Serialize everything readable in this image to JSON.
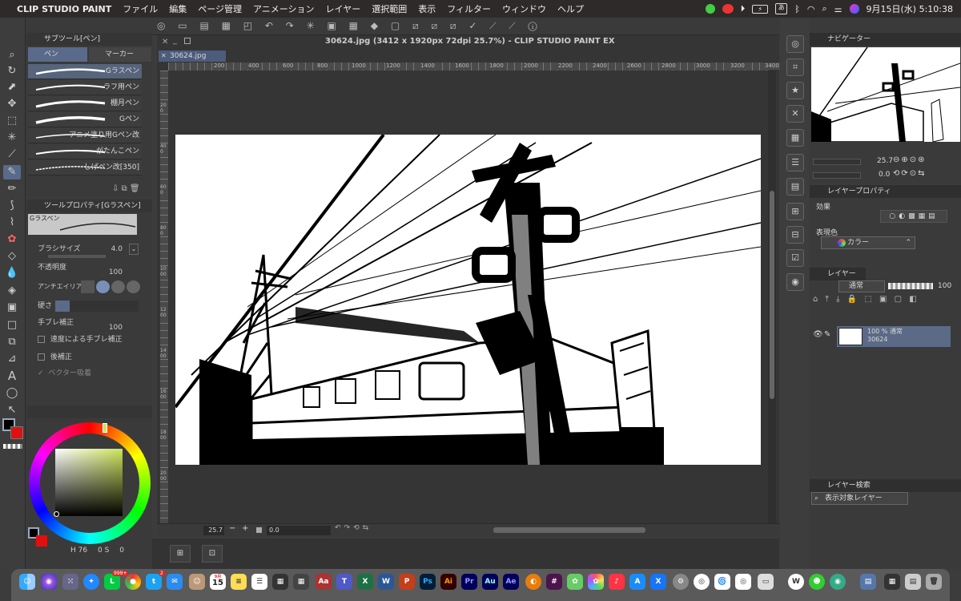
{
  "menubar": {
    "apple_icon": "apple-icon",
    "app_name": "CLIP STUDIO PAINT",
    "items": [
      "ファイル",
      "編集",
      "ページ管理",
      "アニメーション",
      "レイヤー",
      "選択範囲",
      "表示",
      "フィルター",
      "ウィンドウ",
      "ヘルプ"
    ],
    "input_method": "あ",
    "datetime": "9月15日(水)  5:10:38"
  },
  "window_title": "30624.jpg (3412 x 1920px 72dpi 25.7%)  - CLIP STUDIO PAINT EX",
  "document_tab": "30624.jpg",
  "ruler_top": [
    "200",
    "400",
    "600",
    "800",
    "1000",
    "1200",
    "1400",
    "1600",
    "1800",
    "2000",
    "2200",
    "2400",
    "2600",
    "2800",
    "3000",
    "3200",
    "3400"
  ],
  "ruler_left": [
    "200",
    "400",
    "600",
    "800",
    "1000",
    "1200",
    "1400",
    "1600",
    "1800",
    "2000"
  ],
  "subtool_panel": {
    "title": "サブツール[ペン]",
    "tabs": [
      "ペン",
      "マーカー"
    ],
    "brushes": [
      "Gラスペン",
      "ラフ用ペン",
      "棚月ペン",
      "Gペン",
      "アニメ塗り用Gペン改",
      "がたんこペン",
      "しげペン改[350]"
    ]
  },
  "tool_property": {
    "title": "ツールプロパティ[Gラスペン]",
    "preview_label": "Gラスペン",
    "brush_size_label": "ブラシサイズ",
    "brush_size": "4.0",
    "opacity_label": "不透明度",
    "opacity": "100",
    "antialias_label": "アンチエイリアス",
    "hardness_label": "硬さ",
    "stabilization_label": "手ブレ補正",
    "stabilization": "100",
    "speed_stab_label": "速度による手ブレ補正",
    "post_correction_label": "後補正",
    "vector_snap_label": "ベクター吸着"
  },
  "color_panel": {
    "main_color": "#000000",
    "sub_color": "#e01010",
    "h_label": "H",
    "h_value": "76",
    "s_label": "S",
    "s_value": "0",
    "v_label": "V",
    "v_value": "0"
  },
  "canvas_status": {
    "zoom": "25.7",
    "rotation": "0.0"
  },
  "navigator": {
    "title": "ナビゲーター",
    "zoom": "25.7",
    "rotation": "0.0"
  },
  "layer_property": {
    "title": "レイヤープロパティ",
    "effect_label": "効果",
    "expression_label": "表現色",
    "expression_value": "カラー"
  },
  "layer_panel": {
    "title": "レイヤー",
    "blend_mode": "通常",
    "opacity": "100",
    "layers": [
      {
        "line1": "100 % 通常",
        "line2": "30624"
      }
    ]
  },
  "layer_search": {
    "title": "レイヤー検索",
    "filter": "表示対象レイヤー"
  },
  "dock": {
    "badges": [
      "999+",
      "2"
    ],
    "calendar_month": "9月",
    "calendar_day": "15",
    "apps": [
      "finder-icon",
      "siri-icon",
      "launchpad-icon",
      "safari-icon",
      "line-icon",
      "chrome-icon",
      "twitter-icon",
      "mail-icon",
      "contacts-icon",
      "calendar-icon",
      "notes-icon",
      "reminders-icon",
      "calculator-icon",
      "dictionary-icon",
      "teams-icon",
      "excel-icon",
      "word-icon",
      "powerpoint-icon",
      "photoshop-icon",
      "illustrator-icon",
      "premiere-icon",
      "audition-icon",
      "aftereffects-icon",
      "blender-icon",
      "slack-icon",
      "photos-icon",
      "music-icon",
      "appstore-icon",
      "xcode-icon",
      "settings-icon",
      "clipstudio-icon",
      "clipstudio-paint-icon",
      "clipstudio-modeler-icon",
      "preview-icon",
      "wordpress-icon",
      "android-icon",
      "app-icon",
      "folder-icon",
      "trash-icon"
    ]
  }
}
